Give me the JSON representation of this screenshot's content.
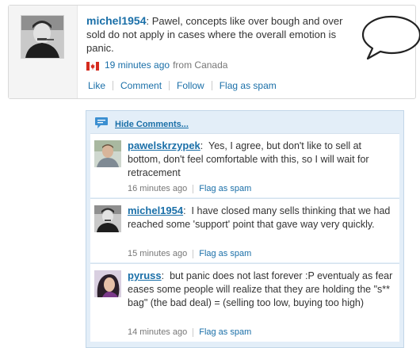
{
  "post": {
    "username": "michel1954",
    "separator": ":",
    "text": "Pawel, concepts like over bough and over sold do not apply in cases where the overall emotion is panic.",
    "time": "19 minutes ago",
    "location": "from Canada",
    "actions": {
      "like": "Like",
      "comment": "Comment",
      "follow": "Follow",
      "flag": "Flag as spam"
    }
  },
  "comments_panel": {
    "toggle_label": "Hide Comments...",
    "items": [
      {
        "username": "pawelskrzypek",
        "separator": ":",
        "text": "Yes, I agree, but don't like to sell at bottom, don't feel comfortable with this, so I will wait for retracement",
        "time": "16 minutes ago",
        "flag": "Flag as spam"
      },
      {
        "username": "michel1954",
        "separator": ":",
        "text": "I have closed many sells thinking that we had reached some 'support' point that gave way very quickly.",
        "time": "15 minutes ago",
        "flag": "Flag as spam"
      },
      {
        "username": "pyruss",
        "separator": ":",
        "text": "but panic does not last forever :P eventualy as fear eases some people will realize that they are holding the \"s** bag\" (the bad deal) = (selling too low, buying too high)",
        "time": "14 minutes ago",
        "flag": "Flag as spam"
      }
    ]
  },
  "icons": {
    "speech_bubble": "speech-bubble-icon",
    "comments": "comments-icon",
    "flag": "canada-flag-icon"
  },
  "colors": {
    "link": "#1a6fa8",
    "panel_bg": "#e3eef8",
    "flag_red": "#d52b1e"
  }
}
